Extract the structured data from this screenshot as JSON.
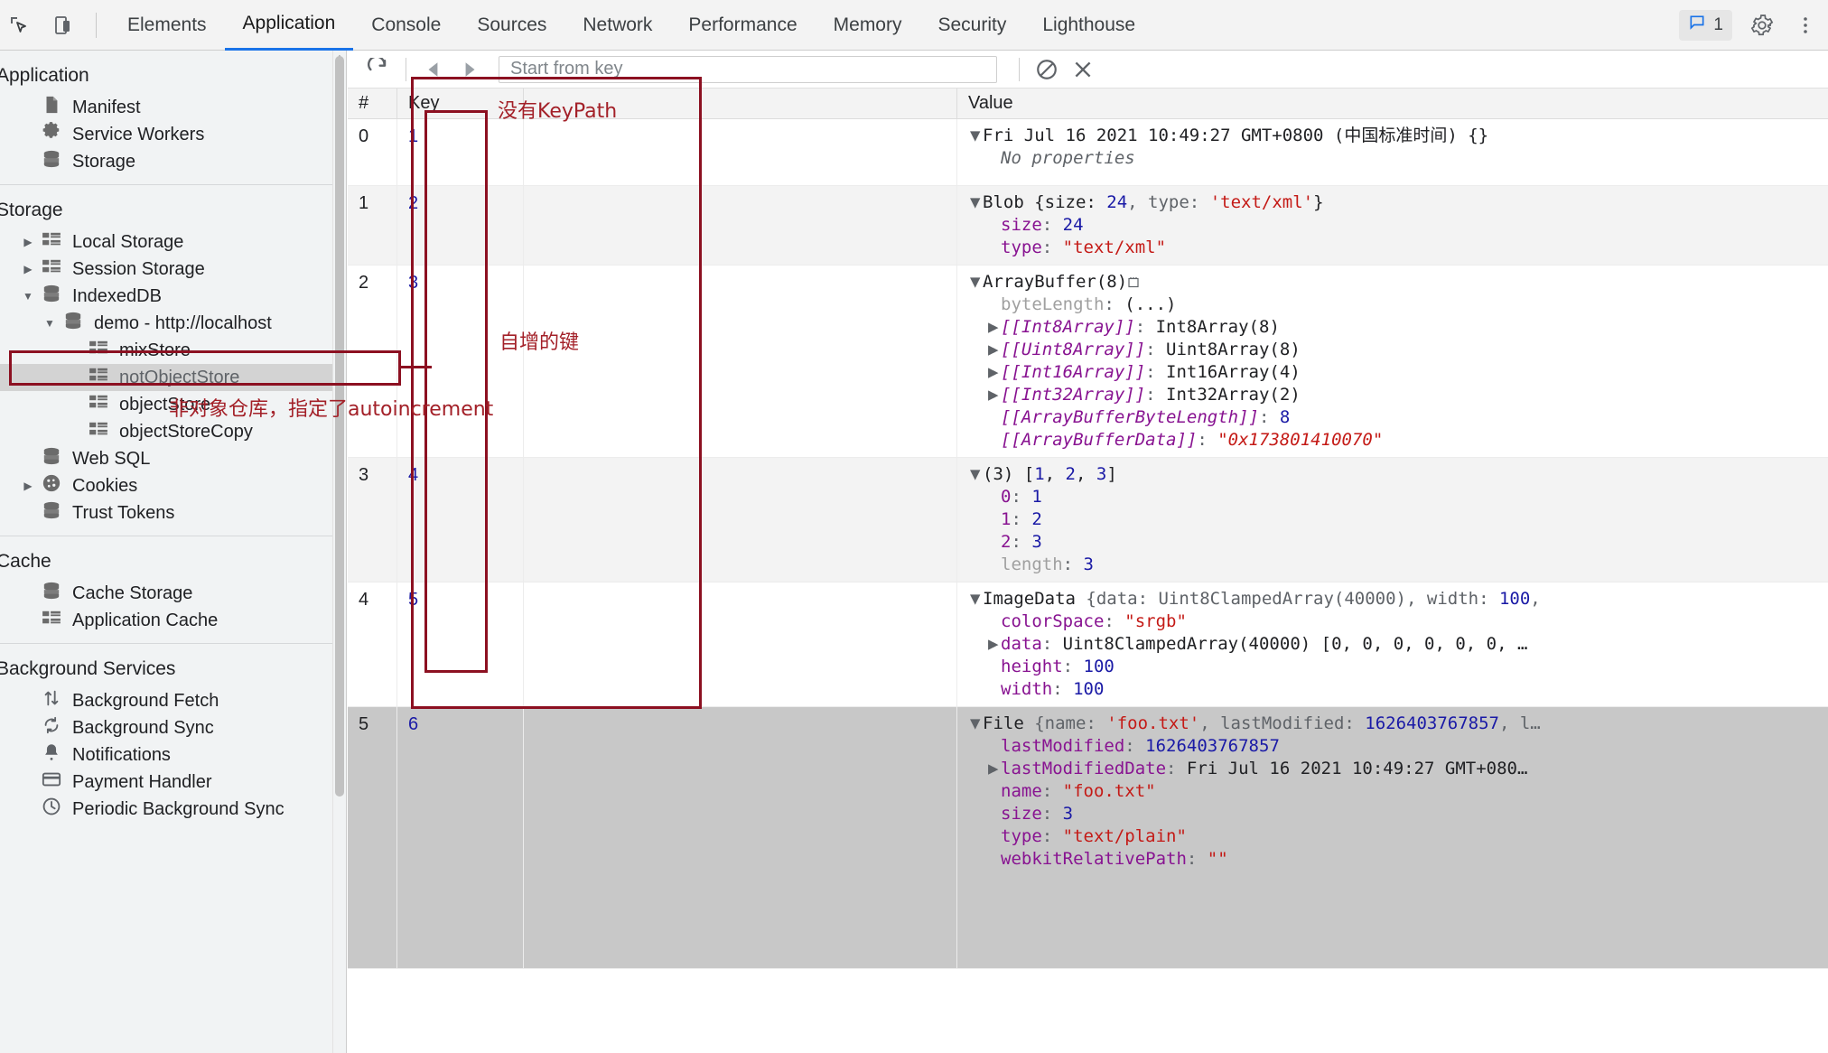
{
  "devtools": {
    "toolbar_icons": [
      "inspect-icon",
      "device-toolbar-icon"
    ],
    "tabs": [
      {
        "label": "Elements",
        "active": false
      },
      {
        "label": "Application",
        "active": true
      },
      {
        "label": "Console",
        "active": false
      },
      {
        "label": "Sources",
        "active": false
      },
      {
        "label": "Network",
        "active": false
      },
      {
        "label": "Performance",
        "active": false
      },
      {
        "label": "Memory",
        "active": false
      },
      {
        "label": "Security",
        "active": false
      },
      {
        "label": "Lighthouse",
        "active": false
      }
    ],
    "message_count": "1",
    "right_icons": [
      "message-icon",
      "gear-icon",
      "kebab-menu-icon"
    ]
  },
  "sidebar": {
    "sections": [
      {
        "title": "Application",
        "items": [
          {
            "label": "Manifest",
            "icon": "manifest-file-icon",
            "indent": 1,
            "twisty": "",
            "selected": false
          },
          {
            "label": "Service Workers",
            "icon": "gear-icon",
            "indent": 1,
            "twisty": "",
            "selected": false
          },
          {
            "label": "Storage",
            "icon": "database-icon",
            "indent": 1,
            "twisty": "",
            "selected": false
          }
        ]
      },
      {
        "title": "Storage",
        "items": [
          {
            "label": "Local Storage",
            "icon": "table-icon",
            "indent": 1,
            "twisty": "collapsed",
            "selected": false
          },
          {
            "label": "Session Storage",
            "icon": "table-icon",
            "indent": 1,
            "twisty": "collapsed",
            "selected": false
          },
          {
            "label": "IndexedDB",
            "icon": "database-icon",
            "indent": 1,
            "twisty": "expanded",
            "selected": false
          },
          {
            "label": "demo - http://localhost",
            "icon": "database-icon",
            "indent": 2,
            "twisty": "expanded",
            "selected": false
          },
          {
            "label": "mixStore",
            "icon": "table-icon",
            "indent": 3,
            "twisty": "",
            "selected": false
          },
          {
            "label": "notObjectStore",
            "icon": "table-icon",
            "indent": 3,
            "twisty": "",
            "selected": true
          },
          {
            "label": "objectStore",
            "icon": "table-icon",
            "indent": 3,
            "twisty": "",
            "selected": false
          },
          {
            "label": "objectStoreCopy",
            "icon": "table-icon",
            "indent": 3,
            "twisty": "",
            "selected": false
          },
          {
            "label": "Web SQL",
            "icon": "database-icon",
            "indent": 1,
            "twisty": "",
            "selected": false
          },
          {
            "label": "Cookies",
            "icon": "cookie-icon",
            "indent": 1,
            "twisty": "collapsed",
            "selected": false
          },
          {
            "label": "Trust Tokens",
            "icon": "database-icon",
            "indent": 1,
            "twisty": "",
            "selected": false
          }
        ]
      },
      {
        "title": "Cache",
        "items": [
          {
            "label": "Cache Storage",
            "icon": "database-icon",
            "indent": 1,
            "twisty": "",
            "selected": false
          },
          {
            "label": "Application Cache",
            "icon": "table-icon",
            "indent": 1,
            "twisty": "",
            "selected": false
          }
        ]
      },
      {
        "title": "Background Services",
        "items": [
          {
            "label": "Background Fetch",
            "icon": "updown-arrows-icon",
            "indent": 1,
            "twisty": "",
            "selected": false
          },
          {
            "label": "Background Sync",
            "icon": "sync-icon",
            "indent": 1,
            "twisty": "",
            "selected": false
          },
          {
            "label": "Notifications",
            "icon": "bell-icon",
            "indent": 1,
            "twisty": "",
            "selected": false
          },
          {
            "label": "Payment Handler",
            "icon": "credit-card-icon",
            "indent": 1,
            "twisty": "",
            "selected": false
          },
          {
            "label": "Periodic Background Sync",
            "icon": "clock-icon",
            "indent": 1,
            "twisty": "",
            "selected": false
          }
        ]
      }
    ]
  },
  "toolbar": {
    "refresh_icon": "refresh-icon",
    "prev_icon": "previous-page-icon",
    "next_icon": "next-page-icon",
    "key_placeholder": "Start from key",
    "key_value": "",
    "clear_icon": "clear-objectstore-icon",
    "delete_icon": "delete-selected-icon"
  },
  "grid": {
    "columns": [
      "#",
      "Key",
      "",
      "Value"
    ],
    "rows": [
      {
        "num": "0",
        "key": "1"
      },
      {
        "num": "1",
        "key": "2"
      },
      {
        "num": "2",
        "key": "3"
      },
      {
        "num": "3",
        "key": "4"
      },
      {
        "num": "4",
        "key": "5"
      },
      {
        "num": "5",
        "key": "6"
      }
    ]
  },
  "values": {
    "row0": {
      "header": "Fri Jul 16 2021 10:49:27 GMT+0800 (中国标准时间) {}",
      "no_properties": "No properties"
    },
    "row1": {
      "header_prefix": "Blob {size: ",
      "header_size": "24",
      "header_mid": ", type: ",
      "header_type": "'text/xml'",
      "header_suffix": "}",
      "props": [
        {
          "key": "size",
          "value": "24",
          "kind": "num"
        },
        {
          "key": "type",
          "value": "\"text/xml\"",
          "kind": "str"
        }
      ]
    },
    "row2": {
      "header": "ArrayBuffer(8)",
      "badge": "memory-inspector-icon",
      "props": [
        {
          "key": "byteLength",
          "value": "(...)",
          "kind": "plain",
          "dim": true
        },
        {
          "key": "[[Int8Array]]",
          "value": "Int8Array(8)",
          "kind": "plain",
          "internal": true,
          "expandable": true
        },
        {
          "key": "[[Uint8Array]]",
          "value": "Uint8Array(8)",
          "kind": "plain",
          "internal": true,
          "expandable": true
        },
        {
          "key": "[[Int16Array]]",
          "value": "Int16Array(4)",
          "kind": "plain",
          "internal": true,
          "expandable": true
        },
        {
          "key": "[[Int32Array]]",
          "value": "Int32Array(2)",
          "kind": "plain",
          "internal": true,
          "expandable": true
        },
        {
          "key": "[[ArrayBufferByteLength]]",
          "value": "8",
          "kind": "num",
          "internal": true
        },
        {
          "key": "[[ArrayBufferData]]",
          "value": "\"0x173801410070\"",
          "kind": "str",
          "internal": true
        }
      ]
    },
    "row3": {
      "header_prefix": "(3) [",
      "header_items": [
        "1",
        "2",
        "3"
      ],
      "header_suffix": "]",
      "props": [
        {
          "key": "0",
          "value": "1",
          "kind": "num"
        },
        {
          "key": "1",
          "value": "2",
          "kind": "num"
        },
        {
          "key": "2",
          "value": "3",
          "kind": "num"
        },
        {
          "key": "length",
          "value": "3",
          "kind": "num",
          "dim": true
        }
      ]
    },
    "row4": {
      "header": "ImageData {data: Uint8ClampedArray(40000), width: 100,",
      "props": [
        {
          "key": "colorSpace",
          "value": "\"srgb\"",
          "kind": "str"
        },
        {
          "key": "data",
          "value": "Uint8ClampedArray(40000) [0, 0, 0, 0, 0, 0, …",
          "kind": "plain",
          "expandable": true
        },
        {
          "key": "height",
          "value": "100",
          "kind": "num"
        },
        {
          "key": "width",
          "value": "100",
          "kind": "num"
        }
      ]
    },
    "row5": {
      "header": "File {name: 'foo.txt', lastModified: 1626403767857, l…",
      "props": [
        {
          "key": "lastModified",
          "value": "1626403767857",
          "kind": "num"
        },
        {
          "key": "lastModifiedDate",
          "value": "Fri Jul 16 2021 10:49:27 GMT+080…",
          "kind": "plain",
          "expandable": true
        },
        {
          "key": "name",
          "value": "\"foo.txt\"",
          "kind": "str"
        },
        {
          "key": "size",
          "value": "3",
          "kind": "num"
        },
        {
          "key": "type",
          "value": "\"text/plain\"",
          "kind": "str"
        },
        {
          "key": "webkitRelativePath",
          "value": "\"\"",
          "kind": "str"
        }
      ]
    }
  },
  "annotations": {
    "no_keypath": "没有KeyPath",
    "auto_key": "自增的键",
    "not_objectstore": "非对象仓库，指定了autoincrement",
    "color": "#8c1021"
  }
}
